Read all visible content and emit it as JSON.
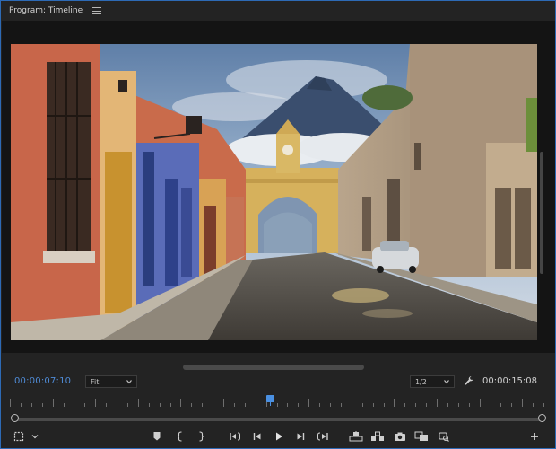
{
  "panel": {
    "title": "Program: Timeline",
    "menu_icon": "hamburger-menu-icon"
  },
  "frame": {
    "description_icon": "video-frame"
  },
  "controls": {
    "current_timecode": "00:00:07:10",
    "zoom_select": "Fit",
    "resolution_select": "1/2",
    "duration_timecode": "00:00:15:08",
    "settings_icon": "wrench-icon"
  },
  "playback": {
    "playhead_fraction": 0.487,
    "zoom_start_fraction": 0.0,
    "zoom_end_fraction": 1.0
  },
  "transport": {
    "left": [
      "safe-margins-icon",
      "chevron-down-icon"
    ],
    "center": [
      "add-marker-icon",
      "mark-in-icon",
      "mark-out-icon",
      "go-to-in-icon",
      "step-back-icon",
      "play-icon",
      "step-forward-icon",
      "go-to-out-icon",
      "lift-icon",
      "extract-icon",
      "export-frame-icon",
      "comparison-view-icon",
      "vr-video-icon"
    ],
    "right": [
      "plus-icon"
    ]
  },
  "colors": {
    "accent": "#4f8bd6",
    "panel_border": "#2d6ab5",
    "background": "#232323"
  }
}
